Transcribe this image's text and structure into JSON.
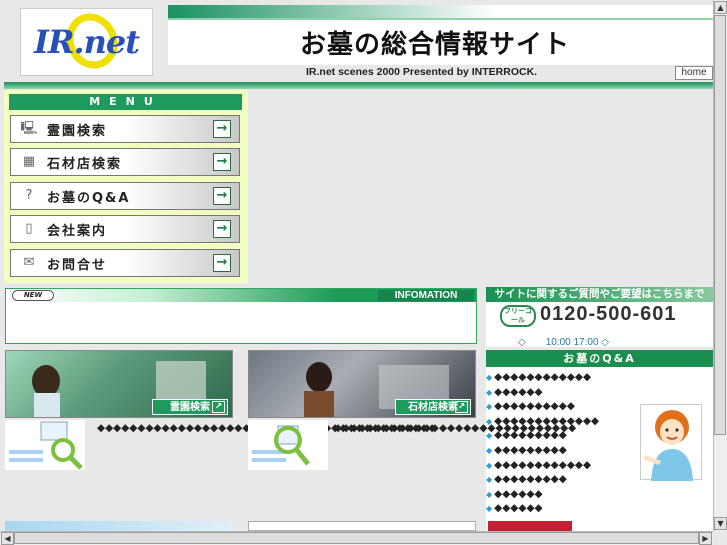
{
  "logo": {
    "text": "IR.net"
  },
  "header": {
    "title": "お墓の総合情報サイト",
    "subtitle": "IR.net scenes 2000 Presented by INTERROCK.",
    "home_label": "home"
  },
  "menu": {
    "heading": "MENU",
    "items": [
      {
        "label": "霊園検索",
        "icon": "computer-icon",
        "arrow": "→"
      },
      {
        "label": "石材店検索",
        "icon": "store-icon",
        "arrow": "→"
      },
      {
        "label": "お墓のQ&A",
        "icon": "question-icon",
        "arrow": "→"
      },
      {
        "label": "会社案内",
        "icon": "building-icon",
        "arrow": "→"
      },
      {
        "label": "お問合せ",
        "icon": "mail-icon",
        "arrow": "→"
      }
    ]
  },
  "news": {
    "new_badge": "NEW",
    "info_label": "INFOMATION"
  },
  "contact": {
    "heading": "サイトに関するご質問やご要望はこちらまで",
    "freecall": "フリーコール",
    "phone": "0120-500-601",
    "hours": "◇　　10:00 17:00 ◇"
  },
  "qa": {
    "heading": "お墓のQ&A",
    "items": [
      "◆◆◆◆◆◆◆◆◆◆◆◆",
      "◆◆◆◆◆◆",
      "◆◆◆◆◆◆◆◆◆◆",
      "◆◆◆◆◆◆◆◆◆◆◆◆◆",
      "◆◆◆◆◆◆◆◆◆",
      "◆◆◆◆◆◆◆◆◆",
      "◆◆◆◆◆◆◆◆◆◆◆◆",
      "◆◆◆◆◆◆◆◆◆",
      "◆◆◆◆◆◆",
      "◆◆◆◆◆◆"
    ]
  },
  "features": [
    {
      "button": "霊園検索",
      "desc": "◆◆◆◆◆◆◆◆◆◆◆◆◆◆◆◆◆◆◆◆◆◆◆◆◆◆◆◆◆◆◆◆◆◆◆◆◆◆◆◆◆◆"
    },
    {
      "button": "石材店検索",
      "desc": "◆◆◆◆◆◆◆◆◆◆◆◆◆◆◆◆◆◆◆◆◆◆◆◆◆◆◆◆◆◆"
    }
  ],
  "colors": {
    "brand_green": "#1a8e4e",
    "menu_bg": "#f0ffc0",
    "accent_blue": "#2750b8"
  }
}
